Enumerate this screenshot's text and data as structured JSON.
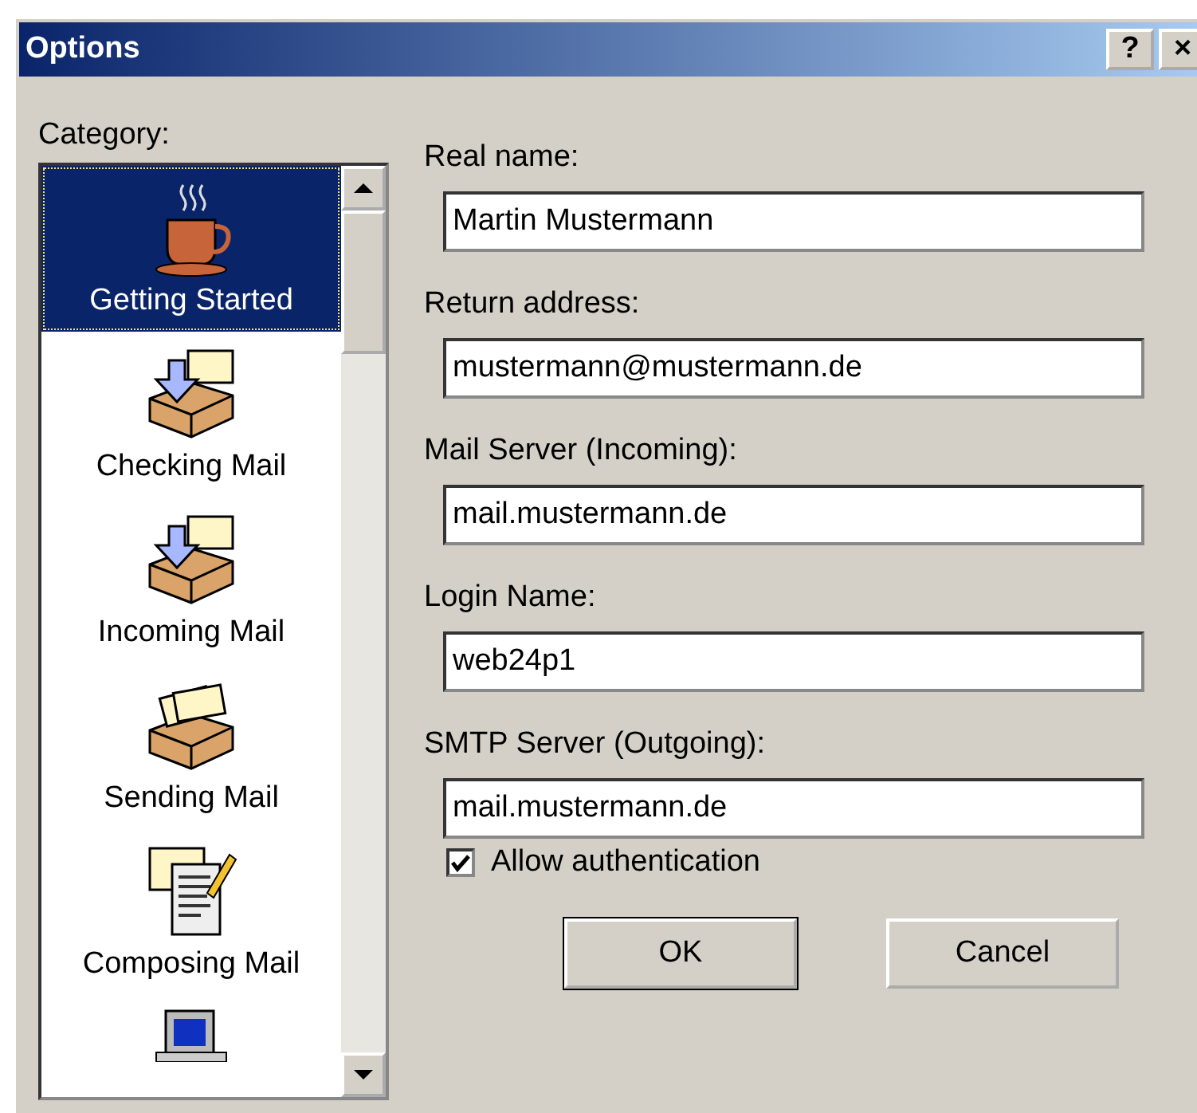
{
  "window": {
    "title": "Options",
    "help_button": "?",
    "close_button": "×"
  },
  "category": {
    "label": "Category:",
    "items": [
      {
        "kind": "cup",
        "label": "Getting Started",
        "selected": true
      },
      {
        "kind": "inbox",
        "label": "Checking Mail",
        "selected": false
      },
      {
        "kind": "inbox",
        "label": "Incoming Mail",
        "selected": false
      },
      {
        "kind": "outbox",
        "label": "Sending Mail",
        "selected": false
      },
      {
        "kind": "compose",
        "label": "Composing Mail",
        "selected": false
      },
      {
        "kind": "computer",
        "selected": false
      }
    ]
  },
  "fields": [
    {
      "label": "Real name:",
      "value": "Martin Mustermann"
    },
    {
      "label": "Return address:",
      "value": "mustermann@mustermann.de"
    },
    {
      "label": "Mail Server (Incoming):",
      "value": "mail.mustermann.de"
    },
    {
      "label": "Login Name:",
      "value": "web24p1"
    },
    {
      "label": "SMTP Server (Outgoing):",
      "value": "mail.mustermann.de"
    }
  ],
  "checkbox": {
    "label": "Allow authentication",
    "checked": true
  },
  "buttons": [
    "OK",
    "Cancel"
  ]
}
